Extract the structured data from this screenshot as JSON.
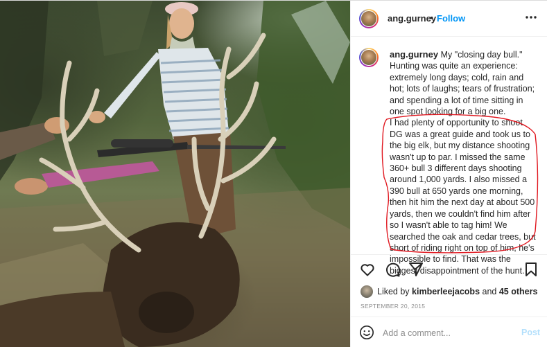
{
  "post": {
    "username": "ang.gurney",
    "separator": "•",
    "follow_label": "Follow",
    "more_icon": "more-horizontal-icon"
  },
  "caption": {
    "username": "ang.gurney",
    "text_part1": "My \"closing day bull.\" Hunting was quite an experience: extremely long days; cold, rain and hot; lots of laughs; tears of frustration; and spending a lot of time sitting in one spot looking for a big one.",
    "text_part2": "I had plenty of opportunity to shoot. DG was a great guide and took us to the big elk, but my distance shooting wasn't up to par. I missed the same 360+ bull 3 different days shooting around 1,000 yards. I also missed a 390 bull at 650 yards one morning, then hit him the next day at about 500 yards, then we couldn't find him after so I wasn't able to tag him! We searched the oak and cedar trees, but short of riding right on top of him, he's impossible to find. That was the biggest disappointment of the hunt.",
    "highlight_color": "#e0171f"
  },
  "actions": {
    "like_icon": "heart-icon",
    "comment_icon": "comment-icon",
    "share_icon": "share-icon",
    "save_icon": "bookmark-icon"
  },
  "likes": {
    "prefix": "Liked by",
    "user": "kimberleejacobs",
    "and": "and",
    "others": "45 others"
  },
  "date": "SEPTEMBER 20, 2015",
  "comment_box": {
    "emoji_icon": "emoji-icon",
    "placeholder": "Add a comment...",
    "post_label": "Post"
  },
  "colors": {
    "accent": "#0095f6",
    "post_disabled": "#b2dffc",
    "muted": "#8e8e8e",
    "text": "#262626"
  }
}
